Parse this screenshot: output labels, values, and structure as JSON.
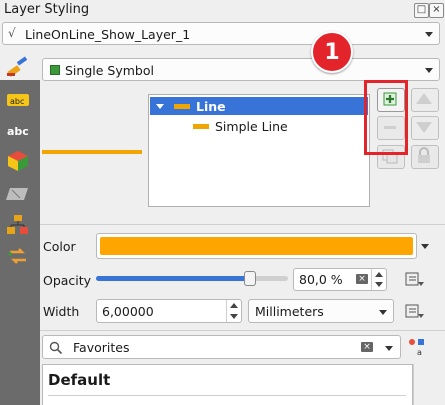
{
  "panel": {
    "title": "Layer Styling"
  },
  "layer_select": {
    "value": "LineOnLine_Show_Layer_1"
  },
  "renderer": {
    "value": "Single Symbol"
  },
  "tree": {
    "items": [
      {
        "label": "Line"
      },
      {
        "label": "Simple Line"
      }
    ]
  },
  "callout": {
    "number": "1"
  },
  "color_row": {
    "label": "Color",
    "swatch": "#ffa500"
  },
  "opacity_row": {
    "label": "Opacity",
    "value": "80,0 %",
    "level": 0.8
  },
  "width_row": {
    "label": "Width",
    "value": "6,00000",
    "unit": "Millimeters"
  },
  "search": {
    "placeholder": "Favorites"
  },
  "library": {
    "group_title": "Default"
  },
  "colors": {
    "accent": "#e8a317",
    "highlight": "#3874d8",
    "callout": "#e3242b"
  }
}
